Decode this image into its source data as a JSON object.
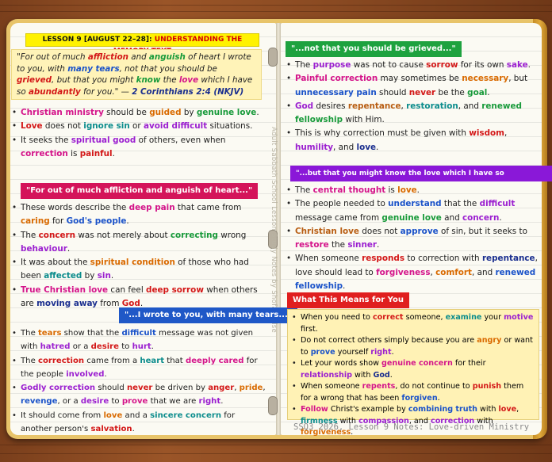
{
  "lesson_title": {
    "prefix": "LESSON 9 [AUGUST 22–28]:",
    "rest": "UNDERSTANDING THE MEMORY TEXT"
  },
  "quote": {
    "t1": "\"For out of much ",
    "w1": "affliction",
    "t2": " and ",
    "w2": "anguish",
    "t3": " of heart I wrote to you, with ",
    "w3": "many tears",
    "t4": ", not that you should be ",
    "w4": "grieved",
    "t5": ", but that you might ",
    "w5": "know",
    "t6": " the ",
    "w6": "love",
    "t7": " which I have so ",
    "w7": "abundantly",
    "t8": " for you.\" — ",
    "ref": "2 Corinthians 2:4 (NKJV)"
  },
  "left1": [
    {
      "a": "Christian ministry",
      "b": " should be ",
      "c": "guided",
      "d": " by ",
      "e": "genuine love",
      "f": "."
    },
    {
      "a": "Love",
      "b": " does not ",
      "c": "ignore sin",
      "d": " or ",
      "e": "avoid difficult",
      "f": " situations."
    },
    {
      "a": "It seeks the ",
      "b": "spiritual good",
      "c": " of others, even when ",
      "d": "correction",
      "e": " is ",
      "f": "painful",
      "g": "."
    }
  ],
  "h_affliction": "\"For out of much affliction and anguish of heart...\"",
  "left2": [
    {
      "a": "These words describe the ",
      "b": "deep pain",
      "c": " that came from ",
      "d": "caring",
      "e": " for ",
      "f": "God's people",
      "g": "."
    },
    {
      "a": "The ",
      "b": "concern",
      "c": " was not merely about ",
      "d": "correcting",
      "e": " wrong ",
      "f": "behaviour",
      "g": "."
    },
    {
      "a": "It was about the ",
      "b": "spiritual condition",
      "c": " of those who had been ",
      "d": "affected",
      "e": " by ",
      "f": "sin",
      "g": "."
    },
    {
      "a": "True Christian love",
      "b": " can feel ",
      "c": "deep sorrow",
      "d": " when others are ",
      "e": "moving away",
      "f": " from ",
      "g": "God",
      "h": "."
    }
  ],
  "h_tears": "\"...I wrote to you, with many tears...\"",
  "left3": [
    {
      "a": "The ",
      "b": "tears",
      "c": " show that the ",
      "d": "difficult",
      "e": " message was not given with ",
      "f": "hatred",
      "g": " or a ",
      "h": "desire",
      "i": " to ",
      "j": "hurt",
      "k": "."
    },
    {
      "a": "The ",
      "b": "correction",
      "c": " came from a ",
      "d": "heart",
      "e": " that ",
      "f": "deeply cared",
      "g": " for the people ",
      "h": "involved",
      "i": "."
    },
    {
      "a": "Godly correction",
      "b": " should ",
      "c": "never",
      "d": " be driven by ",
      "e": "anger",
      "f": ", ",
      "g": "pride",
      "h": ", ",
      "i": "revenge",
      "j": ", or a ",
      "k": "desire",
      "l": " to ",
      "m": "prove",
      "n": " that we are ",
      "o": "right",
      "p": "."
    },
    {
      "a": "It should come from ",
      "b": "love",
      "c": " and a ",
      "d": "sincere concern",
      "e": " for another person's ",
      "f": "salvation",
      "g": "."
    }
  ],
  "sidebar": "Adult Sabbath School Lesson Study Notes by Shofarpulse",
  "h_grieved": "\"...not that you should be grieved...\"",
  "right1": [
    {
      "a": "The ",
      "b": "purpose",
      "c": " was not to cause ",
      "d": "sorrow",
      "e": " for its own ",
      "f": "sake",
      "g": "."
    },
    {
      "a": "Painful correction",
      "b": " may sometimes be ",
      "c": "necessary",
      "d": ", but ",
      "e": "unnecessary pain",
      "f": " should ",
      "g": "never",
      "h": " be the ",
      "i": "goal",
      "j": "."
    },
    {
      "a": "God",
      "b": " desires ",
      "c": "repentance",
      "d": ", ",
      "e": "restoration",
      "f": ", and ",
      "g": "renewed fellowship",
      "h": " with Him."
    },
    {
      "a": "This is why correction must be given with ",
      "b": "wisdom",
      "c": ", ",
      "d": "humility",
      "e": ", and ",
      "f": "love",
      "g": "."
    }
  ],
  "h_know": "\"...but that you might know the love which I have so abundantly for you.\"",
  "right2": [
    {
      "a": "The ",
      "b": "central thought",
      "c": " is ",
      "d": "love",
      "e": "."
    },
    {
      "a": "The people needed to ",
      "b": "understand",
      "c": " that the ",
      "d": "difficult",
      "e": " message came from ",
      "f": "genuine love",
      "g": " and ",
      "h": "concern",
      "i": "."
    },
    {
      "a": "Christian love",
      "b": " does not ",
      "c": "approve",
      "d": " of sin, but it seeks to ",
      "e": "restore",
      "f": " the ",
      "g": "sinner",
      "h": "."
    },
    {
      "a": "When someone ",
      "b": "responds",
      "c": " to correction with ",
      "d": "repentance",
      "e": ", love should lead to ",
      "f": "forgiveness",
      "g": ", ",
      "h": "comfort",
      "i": ", and ",
      "j": "renewed fellowship",
      "k": "."
    }
  ],
  "h_means": "What This Means for You",
  "box": [
    {
      "a": "When you need to ",
      "b": "correct",
      "c": " someone, ",
      "d": "examine",
      "e": " your ",
      "f": "motive",
      "g": " first."
    },
    {
      "a": "Do not correct others simply because you are ",
      "b": "angry",
      "c": " or want to ",
      "d": "prove",
      "e": " yourself ",
      "f": "right",
      "g": "."
    },
    {
      "a": "Let your words show ",
      "b": "genuine concern",
      "c": " for their ",
      "d": "relationship",
      "e": " with ",
      "f": "God",
      "g": "."
    },
    {
      "a": "When someone ",
      "b": "repents",
      "c": ", do not continue to ",
      "d": "punish",
      "e": " them for a wrong that has been ",
      "f": "forgiven",
      "g": "."
    },
    {
      "a": "Follow",
      "b": " Christ's example by ",
      "c": "combining truth",
      "d": " with ",
      "e": "love",
      "f": ", ",
      "g": "firmness",
      "h": " with ",
      "i": "compassion",
      "j": ", and ",
      "k": "correction",
      "l": " with ",
      "m": "forgiveness",
      "n": "."
    }
  ],
  "footer": "SSQ3 2026, Lesson 9 Notes: Love-driven Ministry"
}
